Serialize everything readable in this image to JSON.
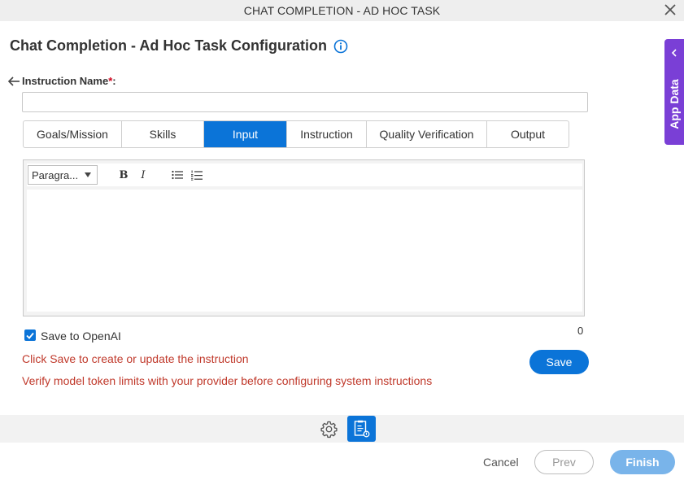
{
  "window": {
    "title": "CHAT COMPLETION - AD HOC TASK"
  },
  "page": {
    "heading": "Chat Completion - Ad Hoc Task Configuration"
  },
  "form": {
    "instruction_name_label": "Instruction Name",
    "required_mark": "*",
    "label_colon": ":",
    "instruction_name_value": ""
  },
  "tabs": [
    {
      "label": "Goals/Mission",
      "active": false
    },
    {
      "label": "Skills",
      "active": false
    },
    {
      "label": "Input",
      "active": true
    },
    {
      "label": "Instruction",
      "active": false
    },
    {
      "label": "Quality Verification",
      "active": false
    },
    {
      "label": "Output",
      "active": false
    }
  ],
  "editor": {
    "paragraph_select": "Paragra...",
    "bold_label": "B",
    "italic_label": "I",
    "content": "",
    "char_count": "0"
  },
  "save_to_openai": {
    "label": "Save to OpenAI",
    "checked": true
  },
  "messages": {
    "save_hint": "Click Save to create or update the instruction",
    "token_hint": "Verify model token limits with your provider before configuring system instructions"
  },
  "buttons": {
    "save": "Save",
    "cancel": "Cancel",
    "prev": "Prev",
    "finish": "Finish"
  },
  "side_panel": {
    "label": "App Data"
  },
  "colors": {
    "accent": "#0b74d8",
    "panel": "#7a3fd6",
    "error": "#c0392b"
  }
}
